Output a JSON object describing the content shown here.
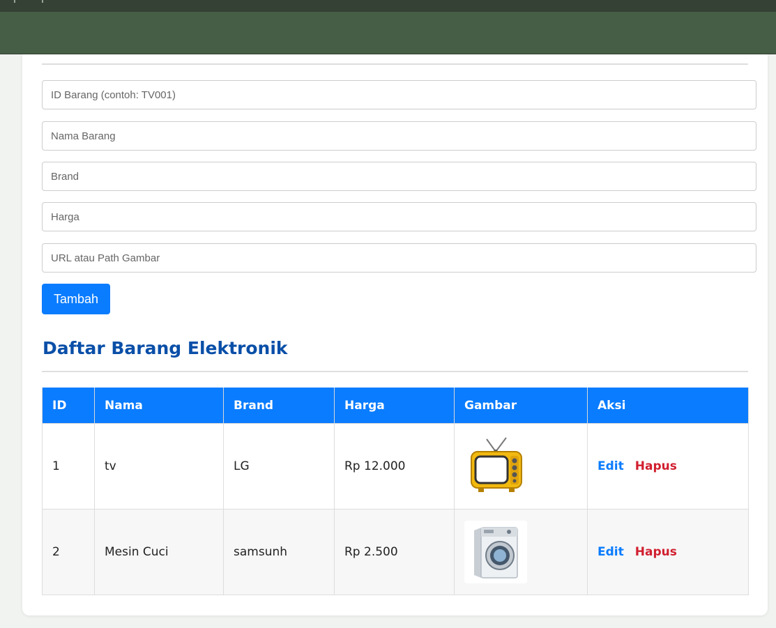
{
  "form": {
    "id_placeholder": "ID Barang (contoh: TV001)",
    "name_placeholder": "Nama Barang",
    "brand_placeholder": "Brand",
    "price_placeholder": "Harga",
    "image_placeholder": "URL atau Path Gambar",
    "submit_label": "Tambah"
  },
  "list": {
    "title": "Daftar Barang Elektronik",
    "columns": {
      "id": "ID",
      "name": "Nama",
      "brand": "Brand",
      "price": "Harga",
      "image": "Gambar",
      "action": "Aksi"
    },
    "rows": [
      {
        "id": "1",
        "name": "tv",
        "brand": "LG",
        "price": "Rp 12.000",
        "image_icon": "retro-tv-icon",
        "edit_label": "Edit",
        "delete_label": "Hapus"
      },
      {
        "id": "2",
        "name": "Mesin Cuci",
        "brand": "samsunh",
        "price": "Rp 2.500",
        "image_icon": "washing-machine-icon",
        "edit_label": "Edit",
        "delete_label": "Hapus"
      }
    ]
  },
  "colors": {
    "navbar": "#465e46",
    "primary": "#0a7cff",
    "title": "#0a4fa8",
    "danger": "#d11f2f"
  }
}
